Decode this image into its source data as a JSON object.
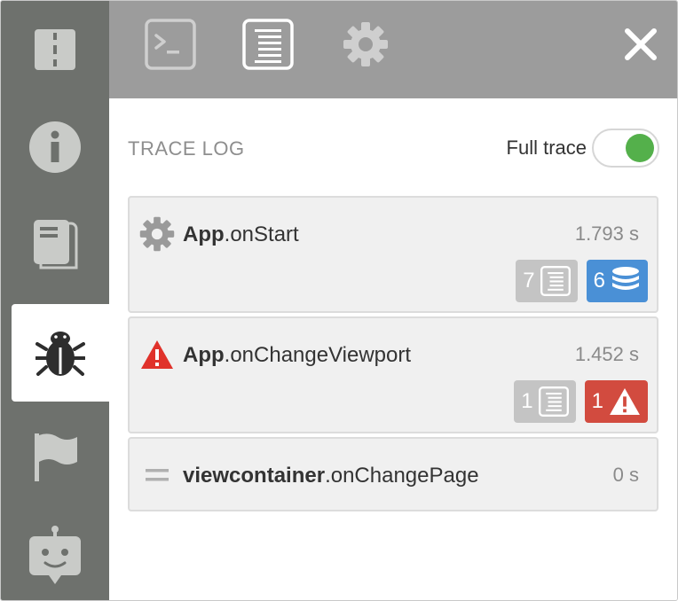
{
  "sidebar": {
    "items": [
      {
        "icon": "roadmap-icon"
      },
      {
        "icon": "info-icon"
      },
      {
        "icon": "documents-icon"
      },
      {
        "icon": "bug-icon",
        "active": true
      },
      {
        "icon": "flag-icon"
      },
      {
        "icon": "robot-chat-icon"
      }
    ]
  },
  "toolbar": {
    "buttons": [
      {
        "icon": "terminal-icon"
      },
      {
        "icon": "log-list-icon",
        "active": true
      },
      {
        "icon": "gear-icon"
      }
    ],
    "close_icon": "close-icon"
  },
  "panel": {
    "title": "TRACE LOG",
    "toggle_label": "Full trace",
    "toggle_on": true
  },
  "traces": [
    {
      "icon": "gear-icon",
      "object": "App",
      "method": ".onStart",
      "time": "1.793 s",
      "badges": [
        {
          "count": "7",
          "icon": "log-list-icon",
          "color": "#c4c4c4"
        },
        {
          "count": "6",
          "icon": "database-icon",
          "color": "#4a90d6"
        }
      ]
    },
    {
      "icon": "warning-icon",
      "object": "App",
      "method": ".onChangeViewport",
      "time": "1.452 s",
      "badges": [
        {
          "count": "1",
          "icon": "log-list-icon",
          "color": "#c4c4c4"
        },
        {
          "count": "1",
          "icon": "warning-icon",
          "color": "#d24b3f"
        }
      ]
    },
    {
      "icon": "equals-icon",
      "object": "viewcontainer",
      "method": ".onChangePage",
      "time": "0 s",
      "badges": []
    }
  ],
  "colors": {
    "sidebar": "#6e716d",
    "topbar": "#9c9c9c",
    "toggle_on": "#54b04b",
    "badge_gray": "#c4c4c4",
    "badge_blue": "#4a90d6",
    "badge_red": "#d24b3f",
    "warning": "#e0322b"
  }
}
